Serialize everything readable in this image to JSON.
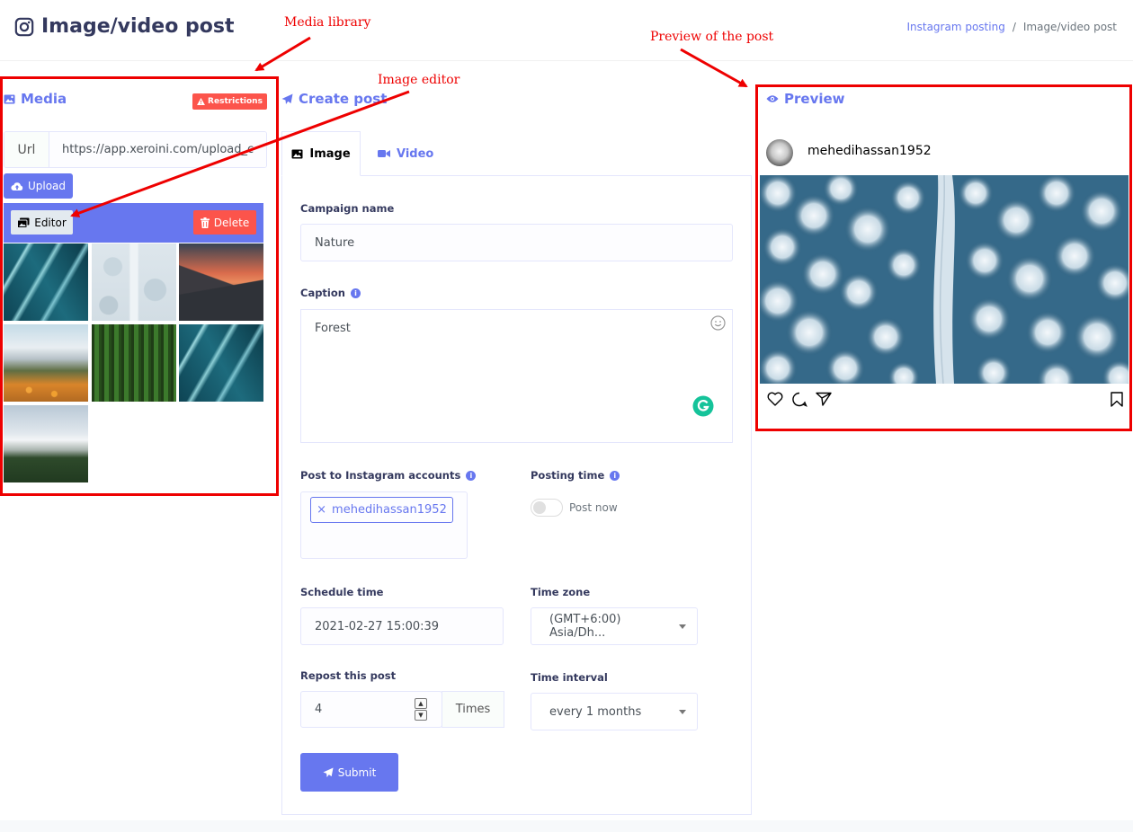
{
  "header": {
    "title": "Image/video post",
    "breadcrumb": [
      "Instagram posting",
      "/",
      "Image/video post"
    ]
  },
  "annotations": {
    "media_library": "Media library",
    "image_editor": "Image editor",
    "preview_of_post": "Preview of the post"
  },
  "media": {
    "title": "Media",
    "restrictions_label": "Restrictions",
    "url_label": "Url",
    "url_value": "https://app.xeroini.com/upload_ca",
    "upload_label": "Upload",
    "editor_label": "Editor",
    "delete_label": "Delete",
    "thumbnails": [
      "teal river delta",
      "snowy forest road",
      "sunset mountain",
      "snowy mountains with orange field",
      "green forest",
      "teal river delta",
      "snowy mountain range"
    ]
  },
  "create_post": {
    "title": "Create post",
    "tabs": [
      {
        "label": "Image",
        "active": true
      },
      {
        "label": "Video",
        "active": false
      }
    ],
    "campaign_name": {
      "label": "Campaign name",
      "value": "Nature"
    },
    "caption": {
      "label": "Caption",
      "value": "Forest"
    },
    "accounts": {
      "label": "Post to Instagram accounts",
      "chip_remove": "×",
      "chip": "mehedihassan1952"
    },
    "posting_time": {
      "label": "Posting time",
      "toggle_label": "Post now",
      "enabled": false
    },
    "schedule_time": {
      "label": "Schedule time",
      "value": "2021-02-27 15:00:39"
    },
    "time_zone": {
      "label": "Time zone",
      "value": "(GMT+6:00) Asia/Dh..."
    },
    "repost": {
      "label": "Repost this post",
      "value": "4",
      "suffix": "Times"
    },
    "time_interval": {
      "label": "Time interval",
      "value": "every 1 months"
    },
    "submit_label": "Submit"
  },
  "preview": {
    "title": "Preview",
    "username": "mehedihassan1952"
  },
  "colors": {
    "primary": "#6777ef",
    "danger": "#fc544b",
    "annotation": "#ee0000"
  }
}
